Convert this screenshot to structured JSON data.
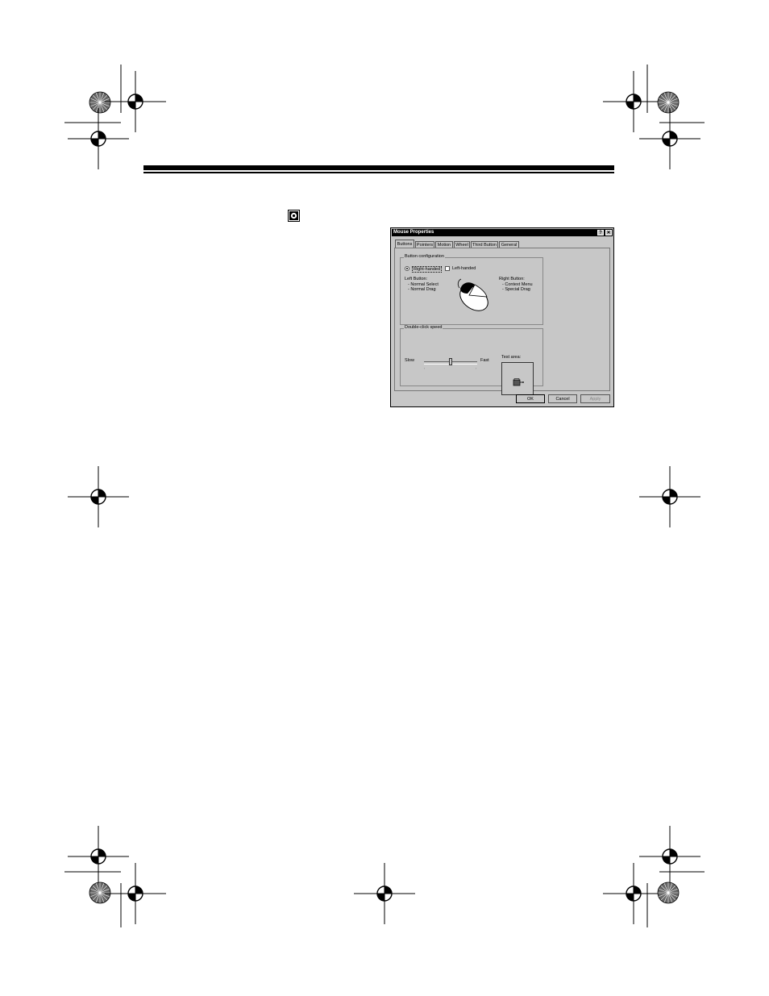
{
  "dialog": {
    "title": "Mouse Properties",
    "help_label": "?",
    "close_label": "✕",
    "tabs": [
      {
        "label": "Buttons",
        "active": true
      },
      {
        "label": "Pointers",
        "active": false
      },
      {
        "label": "Motion",
        "active": false
      },
      {
        "label": "Wheel",
        "active": false
      },
      {
        "label": "Third Button",
        "active": false
      },
      {
        "label": "General",
        "active": false
      }
    ],
    "button_config": {
      "group_label": "Button configuration",
      "right_handed_label": "Right-handed",
      "left_handed_label": "Left-handed",
      "selected": "Right-handed",
      "left_button_title": "Left Button:",
      "left_button_items": [
        "- Normal Select",
        "- Normal Drag"
      ],
      "right_button_title": "Right Button:",
      "right_button_items": [
        "- Context Menu",
        "- Special Drag"
      ]
    },
    "double_click": {
      "group_label": "Double-click speed",
      "slow_label": "Slow",
      "fast_label": "Fast",
      "test_area_label": "Test area:",
      "speed_fraction": 0.5
    },
    "buttons": {
      "ok": "OK",
      "cancel": "Cancel",
      "apply": "Apply"
    }
  }
}
